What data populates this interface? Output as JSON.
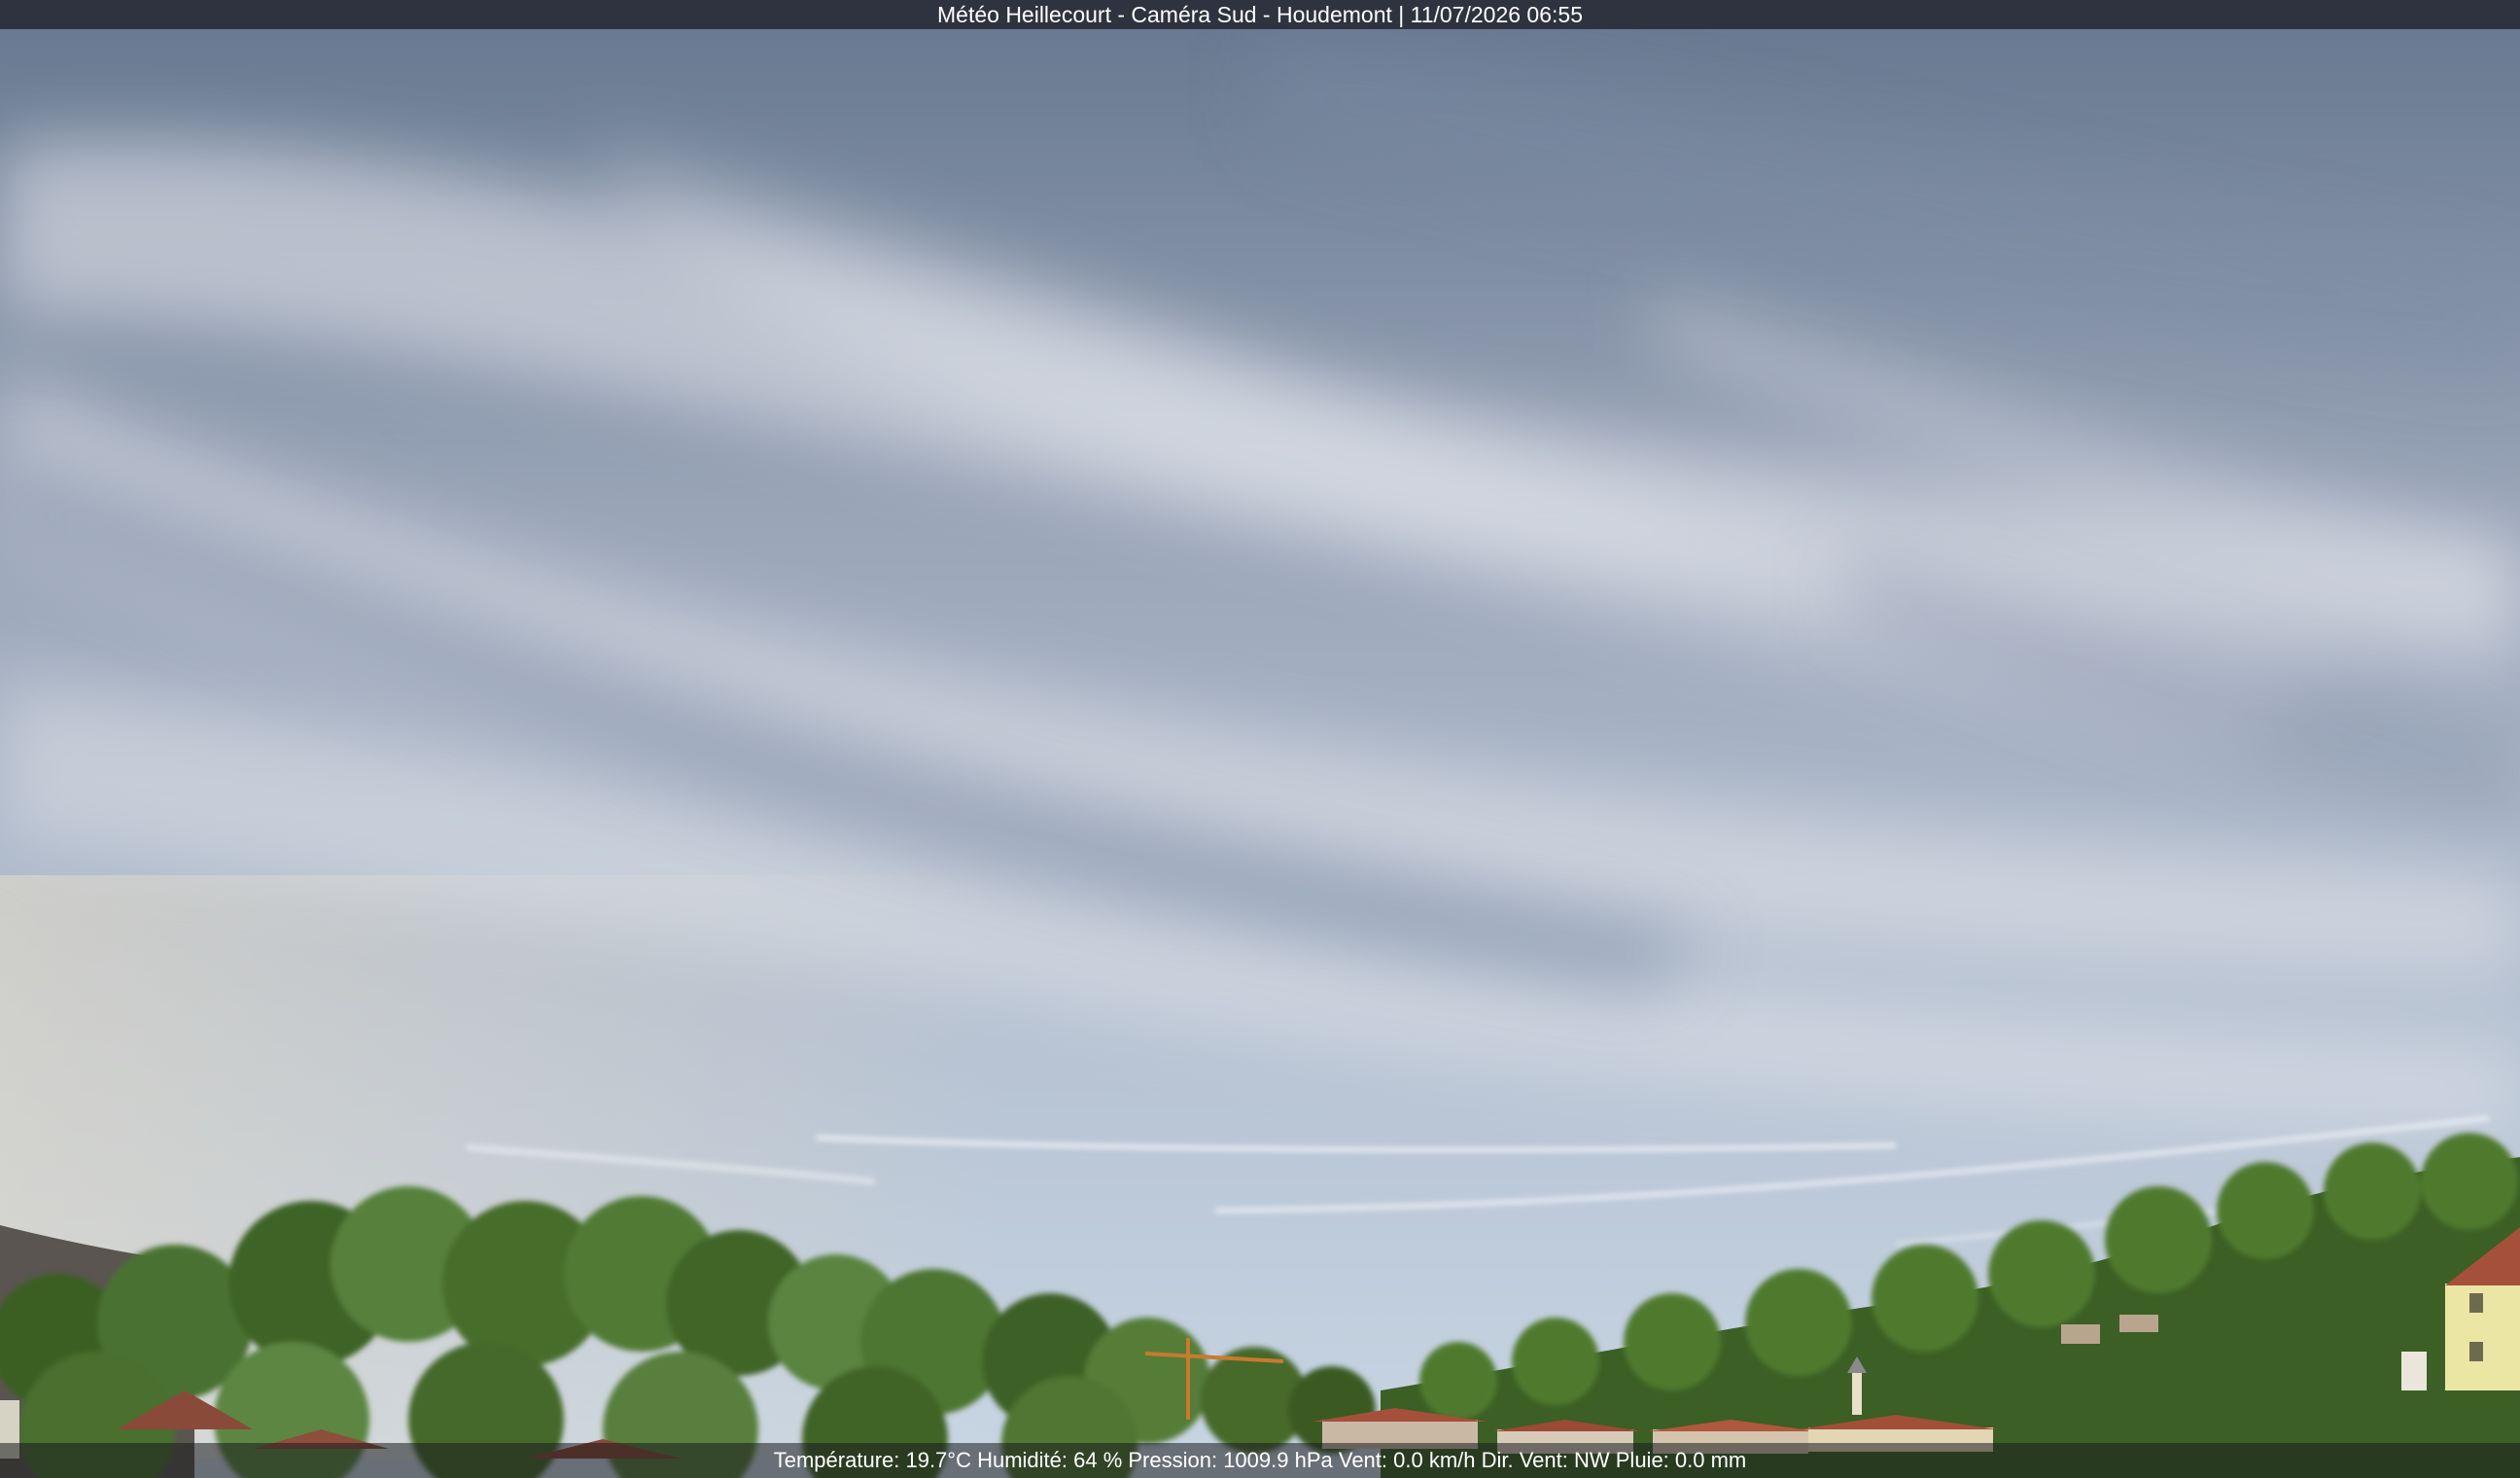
{
  "header": {
    "title": "Météo Heillecourt - Caméra Sud - Houdemont | 11/07/2026 06:55"
  },
  "footer": {
    "weather_readout": "Température: 19.7°C  Humidité: 64 % Pression: 1009.9 hPa Vent: 0.0 km/h Dir. Vent: NW Pluie: 0.0 mm"
  },
  "colors": {
    "sky_top": "#6c7d98",
    "sky_mid": "#a9b3c4",
    "sky_horizon": "#c3d3e2",
    "cloud": "#e6e8ee",
    "foliage": "#4f7a2e",
    "foliage_dark": "#2e4f1c",
    "roof": "#a5503a",
    "house_wall": "#ede7a6",
    "title_bar": "#2f3340"
  }
}
